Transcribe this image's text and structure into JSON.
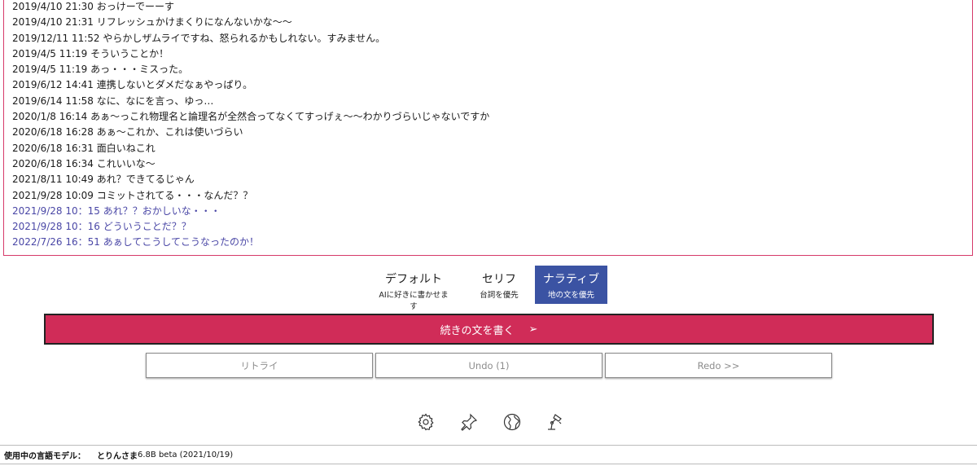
{
  "log": {
    "lines": [
      {
        "text": "2019/4/10 21:30 おっけーでーーす",
        "generated": false
      },
      {
        "text": "2019/4/10 21:31 リフレッシュかけまくりになんないかな〜〜",
        "generated": false
      },
      {
        "text": "2019/12/11 11:52 やらかしザムライですね、怒られるかもしれない。すみません。",
        "generated": false
      },
      {
        "text": "2019/4/5 11:19 そういうことか！",
        "generated": false
      },
      {
        "text": "2019/4/5 11:19 あっ・・・ミスった。",
        "generated": false
      },
      {
        "text": "2019/6/12 14:41 連携しないとダメだなぁやっぱり。",
        "generated": false
      },
      {
        "text": "2019/6/14 11:58 なに、なにを言っ、ゆっ…",
        "generated": false
      },
      {
        "text": "2020/1/8 16:14 あぁ〜っこれ物理名と論理名が全然合ってなくてすっげぇ〜〜わかりづらいじゃないですか",
        "generated": false
      },
      {
        "text": "2020/6/18 16:28 あぁ〜これか、これは使いづらい",
        "generated": false
      },
      {
        "text": "2020/6/18 16:31 面白いねこれ",
        "generated": false
      },
      {
        "text": "2020/6/18 16:34 これいいな〜",
        "generated": false
      },
      {
        "text": "2021/8/11 10:49 あれ？できてるじゃん",
        "generated": false
      },
      {
        "text": "2021/9/28 10:09 コミットされてる・・・なんだ？？",
        "generated": false
      },
      {
        "text": "2021/9/28 10：15 あれ？？おかしいな・・・",
        "generated": true
      },
      {
        "text": "2021/9/28 10：16 どういうことだ？？",
        "generated": true
      },
      {
        "text": "2022/7/26 16：51 あぁしてこうしてこうなったのか！",
        "generated": true
      }
    ]
  },
  "modes": [
    {
      "title": "デフォルト",
      "sub": "AIに好きに書かせます",
      "active": false
    },
    {
      "title": "セリフ",
      "sub": "台詞を優先",
      "active": false
    },
    {
      "title": "ナラティブ",
      "sub": "地の文を優先",
      "active": true
    }
  ],
  "actions": {
    "write_label": "続きの文を書く",
    "write_arrow": "➢",
    "retry_label": "リトライ",
    "undo_label": "Undo (1)",
    "redo_label": "Redo >>"
  },
  "toolbar_icons": [
    "settings-gear-icon",
    "pin-icon",
    "globe-icon",
    "lamp-icon"
  ],
  "footer": {
    "label": "使用中の言語モデル：",
    "model_name": "とりんさま",
    "model_version": "6.8B beta (2021/10/19)"
  },
  "colors": {
    "accent": "#d02c58",
    "active_mode": "#3b53a3",
    "generated_text": "#4a47a6",
    "editor_border": "#d63a6a"
  }
}
